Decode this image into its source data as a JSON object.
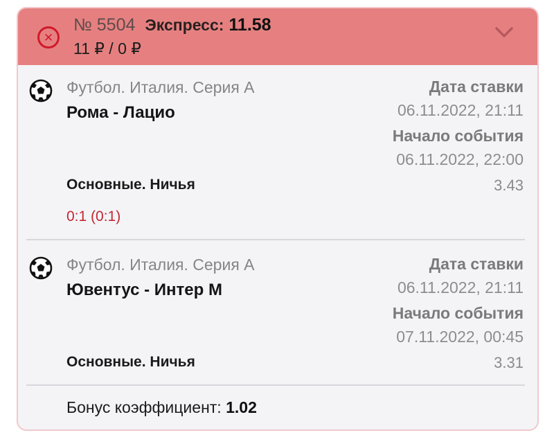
{
  "header": {
    "status_icon": "x-circle-icon",
    "status_color": "#d0192c",
    "background_color": "#e68080",
    "bet_number": "№ 5504",
    "bet_type": "Экспресс:",
    "total_odds": "11.58",
    "stake_payout": "11 ₽ / 0 ₽",
    "expand_icon": "chevron-down-icon"
  },
  "events": [
    {
      "sport_icon": "soccer-ball-icon",
      "league": "Футбол. Италия. Серия А",
      "teams": "Рома - Лацио",
      "bet_date_label": "Дата ставки",
      "bet_date": "06.11.2022, 21:11",
      "event_start_label": "Начало события",
      "event_start": "06.11.2022, 22:00",
      "market": "Основные. Ничья",
      "odds": "3.43",
      "score": "0:1 (0:1)"
    },
    {
      "sport_icon": "soccer-ball-icon",
      "league": "Футбол. Италия. Серия А",
      "teams": "Ювентус - Интер М",
      "bet_date_label": "Дата ставки",
      "bet_date": "06.11.2022, 21:11",
      "event_start_label": "Начало события",
      "event_start": "07.11.2022, 00:45",
      "market": "Основные. Ничья",
      "odds": "3.31"
    }
  ],
  "bonus": {
    "label": "Бонус коэффициент:",
    "value": "1.02"
  }
}
